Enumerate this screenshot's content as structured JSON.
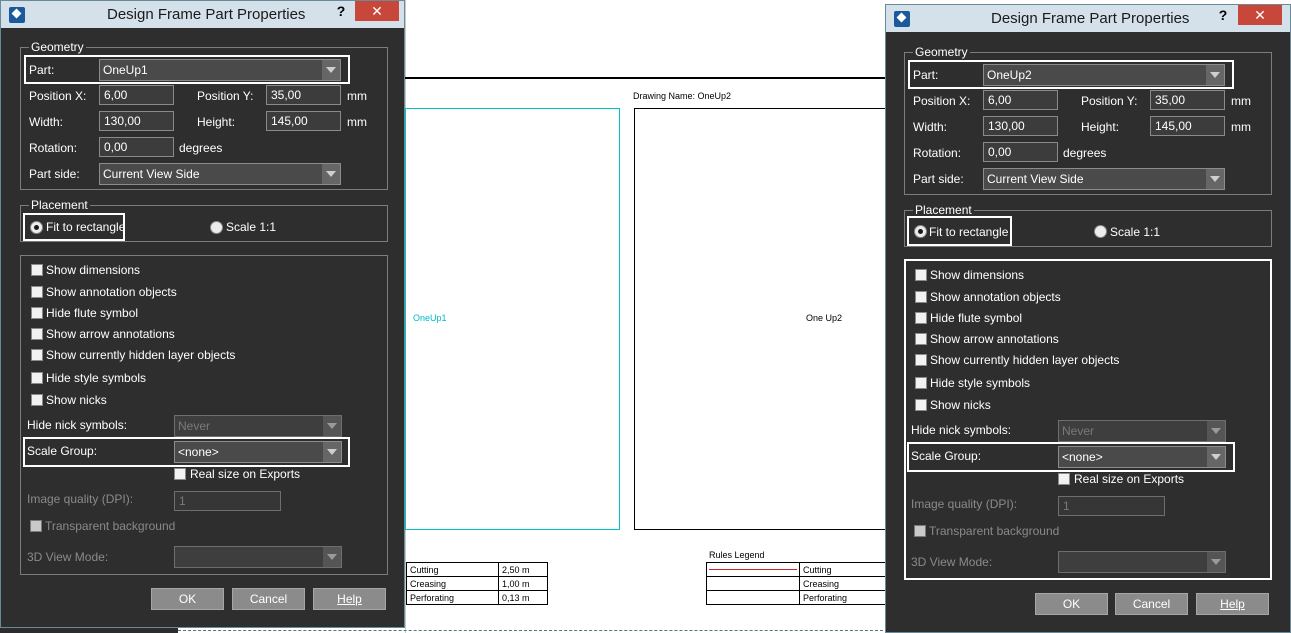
{
  "drawing": {
    "drawing_name_label": "Drawing Name: OneUp2",
    "frame1_label": "OneUp1",
    "frame2_label": "One Up2",
    "table1": [
      [
        "Cutting",
        "2,50 m"
      ],
      [
        "Creasing",
        "1,00 m"
      ],
      [
        "Perforating",
        "0,13 m"
      ]
    ],
    "legend_title": "Rules Legend",
    "table2": [
      "Cutting",
      "Creasing",
      "Perforating"
    ],
    "colors": {
      "frame1_border": "#00c3c3",
      "frame1_label": "#00b8c8",
      "cutting_line": "#d42020"
    }
  },
  "dialogs": [
    {
      "title": "Design Frame Part Properties",
      "help_glyph": "?",
      "close_glyph": "✕",
      "geometry": {
        "group_title": "Geometry",
        "part_label": "Part:",
        "part_value": "OneUp1",
        "posx_label": "Position X:",
        "posx_value": "6,00",
        "posy_label": "Position Y:",
        "posy_value": "35,00",
        "posy_unit": "mm",
        "width_label": "Width:",
        "width_value": "130,00",
        "height_label": "Height:",
        "height_value": "145,00",
        "height_unit": "mm",
        "rotation_label": "Rotation:",
        "rotation_value": "0,00",
        "rotation_unit": "degrees",
        "partside_label": "Part side:",
        "partside_value": "Current View Side"
      },
      "placement": {
        "group_title": "Placement",
        "fit_label": "Fit to rectangle",
        "fit_selected": true,
        "scale_label": "Scale 1:1"
      },
      "options": {
        "checkboxes": [
          "Show dimensions",
          "Show annotation objects",
          "Hide flute symbol",
          "Show arrow annotations",
          "Show currently hidden layer objects",
          "Hide style symbols",
          "Show nicks"
        ],
        "nick_label": "Hide nick symbols:",
        "nick_value": "Never",
        "scale_group_label": "Scale Group:",
        "scale_group_value": "<none>",
        "real_size_label": "Real size on Exports",
        "dpi_label": "Image quality (DPI):",
        "dpi_value": "1",
        "transparent_label": "Transparent background",
        "view3d_label": "3D View Mode:",
        "view3d_value": ""
      },
      "buttons": {
        "ok": "OK",
        "cancel": "Cancel",
        "help": "Help"
      }
    },
    {
      "title": "Design Frame Part Properties",
      "help_glyph": "?",
      "close_glyph": "✕",
      "geometry": {
        "group_title": "Geometry",
        "part_label": "Part:",
        "part_value": "OneUp2",
        "posx_label": "Position X:",
        "posx_value": "6,00",
        "posy_label": "Position Y:",
        "posy_value": "35,00",
        "posy_unit": "mm",
        "width_label": "Width:",
        "width_value": "130,00",
        "height_label": "Height:",
        "height_value": "145,00",
        "height_unit": "mm",
        "rotation_label": "Rotation:",
        "rotation_value": "0,00",
        "rotation_unit": "degrees",
        "partside_label": "Part side:",
        "partside_value": "Current View Side"
      },
      "placement": {
        "group_title": "Placement",
        "fit_label": "Fit to rectangle",
        "fit_selected": true,
        "scale_label": "Scale 1:1"
      },
      "options": {
        "checkboxes": [
          "Show dimensions",
          "Show annotation objects",
          "Hide flute symbol",
          "Show arrow annotations",
          "Show currently hidden layer objects",
          "Hide style symbols",
          "Show nicks"
        ],
        "nick_label": "Hide nick symbols:",
        "nick_value": "Never",
        "scale_group_label": "Scale Group:",
        "scale_group_value": "<none>",
        "real_size_label": "Real size on Exports",
        "dpi_label": "Image quality (DPI):",
        "dpi_value": "1",
        "transparent_label": "Transparent background",
        "view3d_label": "3D View Mode:",
        "view3d_value": ""
      },
      "buttons": {
        "ok": "OK",
        "cancel": "Cancel",
        "help": "Help"
      }
    }
  ]
}
